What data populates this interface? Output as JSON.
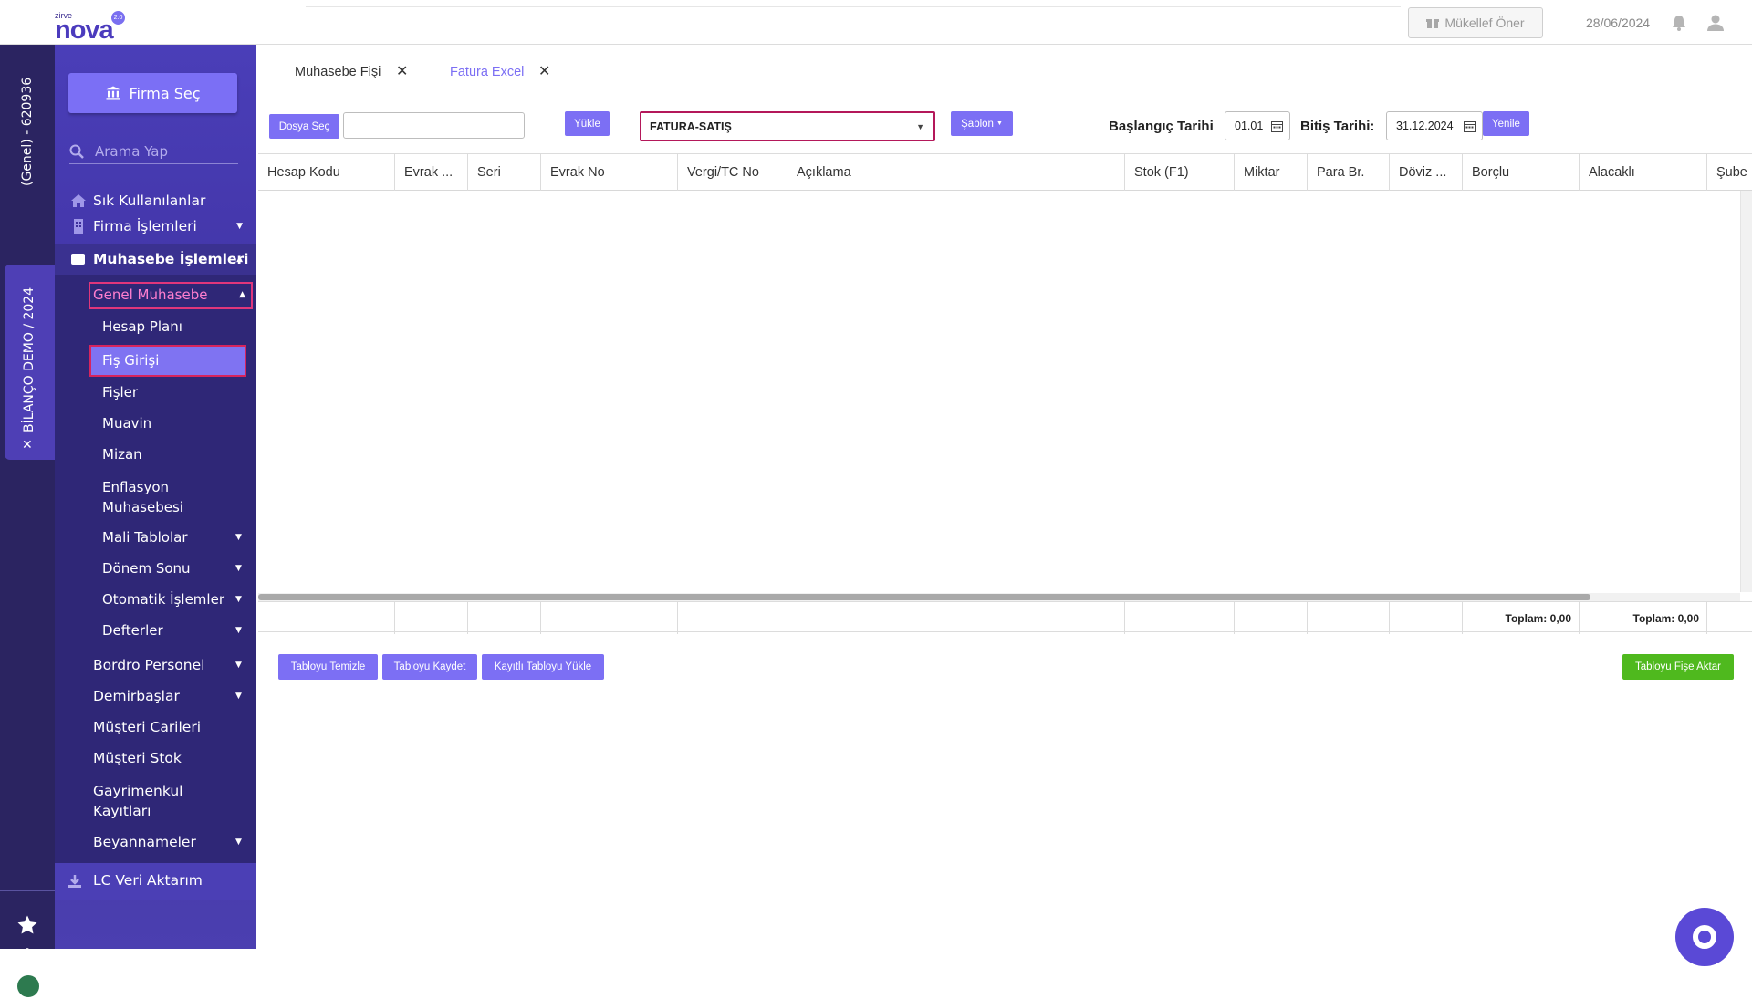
{
  "app": {
    "logo_small": "zirve",
    "logo_main": "nova",
    "logo_badge": "2.0"
  },
  "topbar": {
    "mukellef_label": "Mükellef Öner",
    "date": "28/06/2024"
  },
  "leftbar": {
    "account_text": "(Genel) - 620936",
    "demo_text": "BİLANÇO DEMO / 2024",
    "demo_close": "✕"
  },
  "sidebar": {
    "firma_label": "Firma Seç",
    "search_placeholder": "Arama Yap",
    "items": [
      {
        "label": "Sık Kullanılanlar"
      },
      {
        "label": "Firma İşlemleri"
      },
      {
        "label": "Muhasebe İşlemleri"
      },
      {
        "label": "Genel Muhasebe"
      },
      {
        "label": "Hesap Planı"
      },
      {
        "label": "Fiş Girişi"
      },
      {
        "label": "Fişler"
      },
      {
        "label": "Muavin"
      },
      {
        "label": "Mizan"
      },
      {
        "label": "Enflasyon Muhasebesi"
      },
      {
        "label": "Mali Tablolar"
      },
      {
        "label": "Dönem Sonu"
      },
      {
        "label": "Otomatik İşlemler"
      },
      {
        "label": "Defterler"
      },
      {
        "label": "Bordro Personel"
      },
      {
        "label": "Demirbaşlar"
      },
      {
        "label": "Müşteri Carileri"
      },
      {
        "label": "Müşteri Stok"
      },
      {
        "label": "Gayrimenkul Kayıtları"
      },
      {
        "label": "Beyannameler"
      },
      {
        "label": "LC Veri Aktarım"
      }
    ]
  },
  "tabs": [
    {
      "label": "Muhasebe Fişi"
    },
    {
      "label": "Fatura Excel"
    }
  ],
  "toolbar": {
    "dosya_sec": "Dosya Seç",
    "yukle": "Yükle",
    "template_select": "FATURA-SATIŞ",
    "sablon": "Şablon",
    "baslangic_label": "Başlangıç Tarihi",
    "baslangic_value": "01.01",
    "bitis_label": "Bitiş Tarihi:",
    "bitis_value": "31.12.2024",
    "yenile": "Yenile"
  },
  "table": {
    "columns": [
      "Hesap Kodu",
      "Evrak ...",
      "Seri",
      "Evrak No",
      "Vergi/TC No",
      "Açıklama",
      "Stok (F1)",
      "Miktar",
      "Para Br.",
      "Döviz ...",
      "Borçlu",
      "Alacaklı",
      "Şube"
    ],
    "totals": {
      "borclu": "Toplam: 0,00",
      "alacakli": "Toplam: 0,00"
    }
  },
  "actions": {
    "temizle": "Tabloyu Temizle",
    "kaydet": "Tabloyu Kaydet",
    "kayitli_yukle": "Kayıtlı Tabloyu Yükle",
    "fise_aktar": "Tabloyu Fişe Aktar"
  },
  "colors": {
    "accent": "#7c6ff4",
    "sidebar": "#3d2f9b",
    "highlight_border": "#d7245e",
    "success": "#4fb91e"
  }
}
